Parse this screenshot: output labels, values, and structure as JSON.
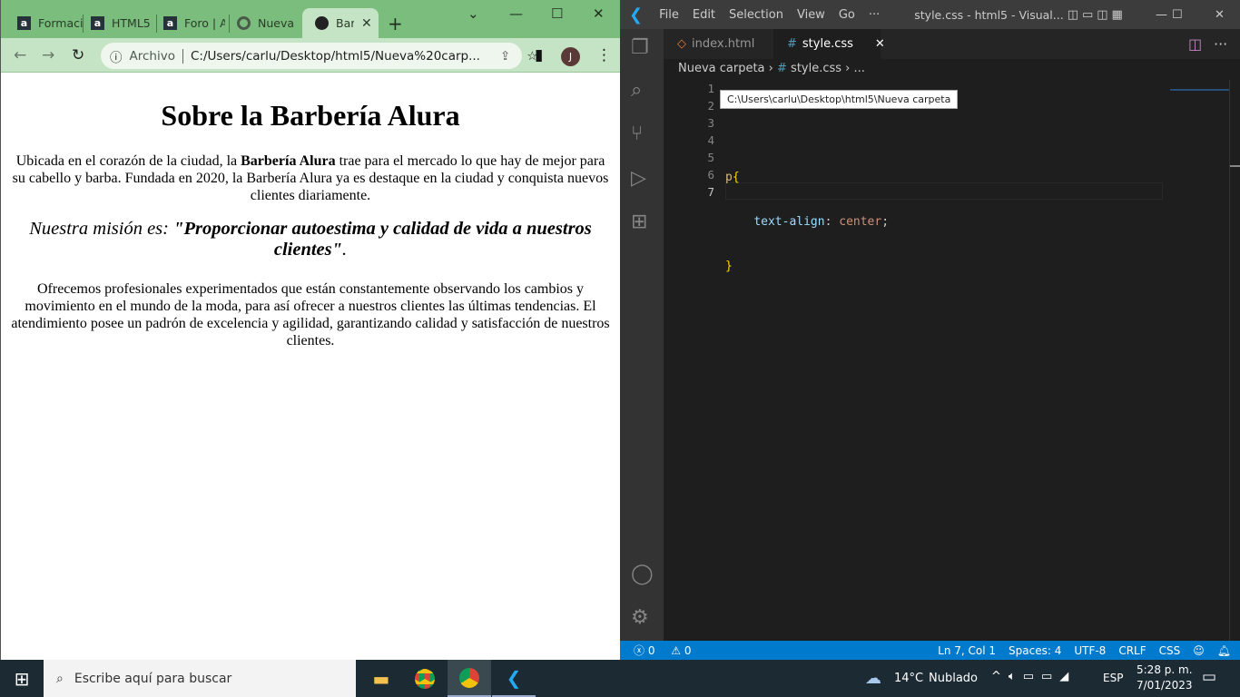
{
  "browser": {
    "tabs": [
      {
        "label": "Formaci",
        "icon": "alura-icon"
      },
      {
        "label": "HTML5",
        "icon": "alura-icon"
      },
      {
        "label": "Foro | A",
        "icon": "alura-icon"
      },
      {
        "label": "Nueva",
        "icon": "chrome-icon"
      },
      {
        "label": "Bark",
        "icon": "globe-icon",
        "active": true
      }
    ],
    "address_prefix": "Archivo",
    "url": "C:/Users/carlu/Desktop/html5/Nueva%20carp...",
    "profile_initial": "J",
    "tab_color": "#7bbd7c"
  },
  "page": {
    "title": "Sobre la Barbería Alura",
    "p1_before": "Ubicada en el corazón de la ciudad, la ",
    "p1_bold": "Barbería Alura",
    "p1_after": " trae para el mercado lo que hay de mejor para su cabello y barba. Fundada en 2020, la Barbería Alura ya es destaque en la ciudad y conquista nuevos clientes diariamente.",
    "mission_prefix": "Nuestra misión es: ",
    "mission_bold": "\"Proporcionar autoestima y calidad de vida a nuestros clientes\"",
    "mission_suffix": ".",
    "p2": "Ofrecemos profesionales experimentados que están constantemente observando los cambios y movimiento en el mundo de la moda, para así ofrecer a nuestros clientes las últimas tendencias. El atendimiento posee un padrón de excelencia y agilidad, garantizando calidad y satisfacción de nuestros clientes."
  },
  "vscode": {
    "menu": [
      "File",
      "Edit",
      "Selection",
      "View",
      "Go",
      "···"
    ],
    "window_title": "style.css - html5 - Visual...",
    "tabs": [
      {
        "label": "index.html"
      },
      {
        "label": "style.css",
        "active": true
      }
    ],
    "breadcrumb": [
      "Nueva carpeta",
      "style.css",
      "..."
    ],
    "tooltip": "C:\\Users\\carlu\\Desktop\\html5\\Nueva carpeta",
    "line_numbers": [
      "1",
      "2",
      "3",
      "4",
      "5",
      "6",
      "7"
    ],
    "code": {
      "selector": "p",
      "open": "{",
      "property": "text-align",
      "colon": ": ",
      "value": "center",
      "semi": ";",
      "close": "}"
    },
    "status": {
      "errors": "0",
      "warnings": "0",
      "position": "Ln 7, Col 1",
      "spaces": "Spaces: 4",
      "encoding": "UTF-8",
      "eol": "CRLF",
      "language": "CSS"
    },
    "accent": "#007acc"
  },
  "taskbar": {
    "search_placeholder": "Escribe aquí para buscar",
    "weather": "14°C",
    "weather_desc": "Nublado",
    "lang": "ESP",
    "time": "5:28 p. m.",
    "date": "7/01/2023"
  }
}
